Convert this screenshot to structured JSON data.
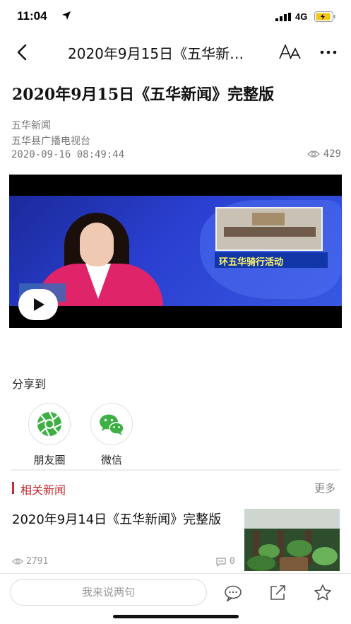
{
  "status_bar": {
    "time": "11:04",
    "network": "4G"
  },
  "nav": {
    "title": "2020年9月15日《五华新…",
    "icons": [
      "back-icon",
      "font-size-icon",
      "more-icon"
    ]
  },
  "article": {
    "title": "2020年9月15日《五华新闻》完整版",
    "source": "五华新闻",
    "station": "五华县广播电视台",
    "datetime": "2020-09-16 08:49:44",
    "views": "429"
  },
  "video": {
    "caption": "环五华骑行活动"
  },
  "share": {
    "title": "分享到",
    "items": [
      {
        "label": "朋友圈",
        "icon": "moments-icon"
      },
      {
        "label": "微信",
        "icon": "wechat-icon"
      }
    ]
  },
  "related": {
    "title": "相关新闻",
    "more": "更多",
    "items": [
      {
        "title": "2020年9月14日《五华新闻》完整版",
        "views": "2791",
        "comments": "0"
      }
    ]
  },
  "bottom_bar": {
    "comment_placeholder": "我来说两句",
    "icons": [
      "comment-icon",
      "share-icon",
      "star-icon"
    ]
  },
  "colors": {
    "accent": "#c8262c",
    "wechat_green": "#3cb043"
  }
}
